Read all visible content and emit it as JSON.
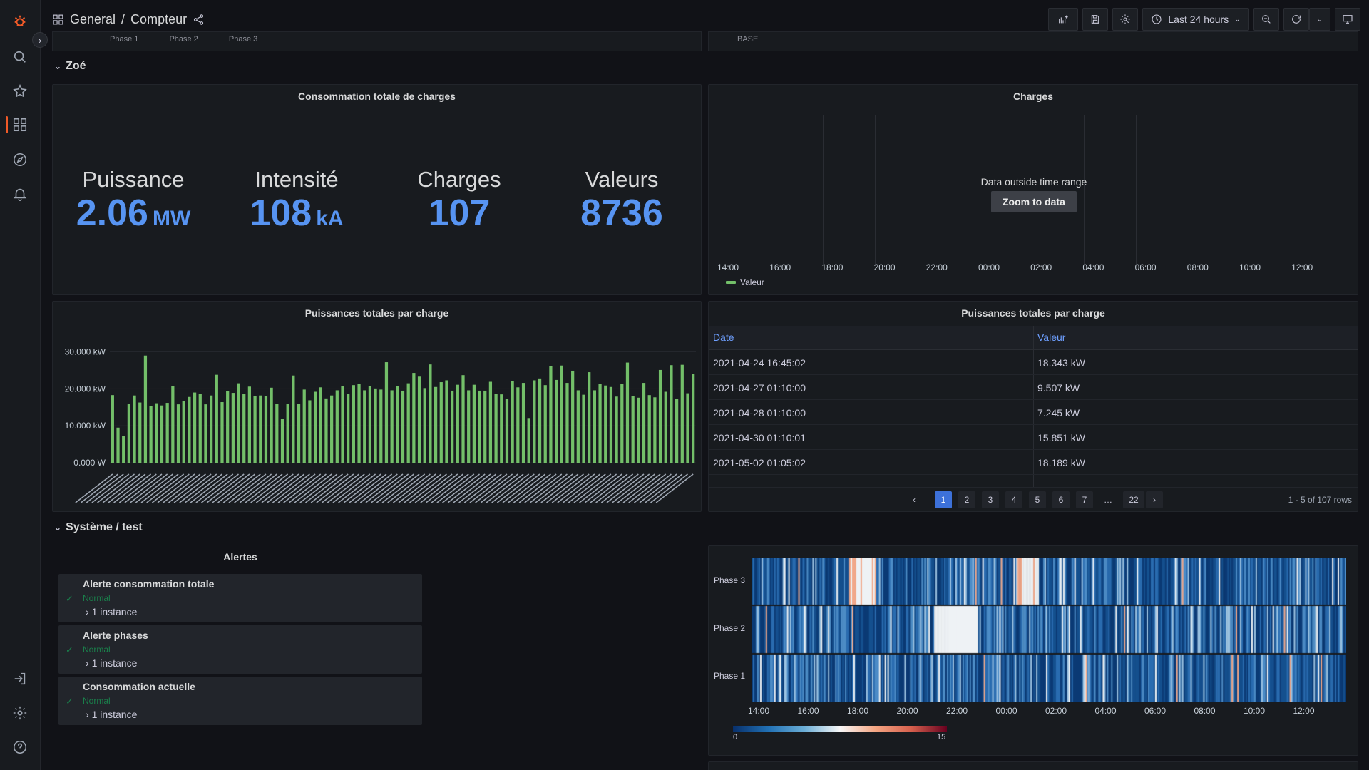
{
  "header": {
    "folder": "General",
    "separator": "/",
    "dashboard": "Compteur",
    "time_range": "Last 24 hours"
  },
  "partial_rows": {
    "left_labels": [
      "Phase 1",
      "Phase 2",
      "Phase 3"
    ],
    "right_label": "BASE"
  },
  "rows": [
    {
      "title": "Zoé"
    },
    {
      "title": "Système / test"
    }
  ],
  "stats_panel": {
    "title": "Consommation totale de charges",
    "stats": [
      {
        "label": "Puissance",
        "value": "2.06",
        "unit": "MW"
      },
      {
        "label": "Intensité",
        "value": "108",
        "unit": "kA"
      },
      {
        "label": "Charges",
        "value": "107",
        "unit": ""
      },
      {
        "label": "Valeurs",
        "value": "8736",
        "unit": ""
      }
    ]
  },
  "charges_panel": {
    "title": "Charges",
    "no_data_text": "Data outside time range",
    "zoom_button": "Zoom to data",
    "x_ticks": [
      "14:00",
      "16:00",
      "18:00",
      "20:00",
      "22:00",
      "00:00",
      "02:00",
      "04:00",
      "06:00",
      "08:00",
      "10:00",
      "12:00"
    ],
    "legend": "Valeur"
  },
  "bar_panel": {
    "title": "Puissances totales par charge",
    "bar_color": "#73bf69",
    "chart_data": {
      "type": "bar",
      "title": "Puissances totales par charge",
      "ylim": [
        0,
        33
      ],
      "y_ticks": [
        "30.000 kW",
        "20.000 kW",
        "10.000 kW",
        "0.000 W"
      ],
      "y_tick_values": [
        30,
        20,
        10,
        0
      ],
      "values": [
        18.3,
        9.5,
        7.2,
        15.9,
        18.2,
        16.3,
        29.0,
        15.4,
        16.1,
        15.5,
        16.2,
        20.8,
        15.8,
        16.7,
        17.8,
        19.0,
        18.6,
        15.8,
        18.2,
        23.8,
        16.4,
        19.4,
        18.9,
        21.5,
        18.7,
        20.6,
        18.0,
        18.2,
        18.1,
        20.3,
        15.9,
        11.8,
        15.9,
        23.6,
        16.0,
        19.8,
        16.9,
        19.2,
        20.4,
        17.4,
        18.2,
        19.6,
        20.8,
        18.6,
        21.0,
        21.3,
        19.6,
        20.8,
        20.1,
        19.8,
        27.2,
        19.6,
        20.7,
        19.5,
        21.5,
        24.3,
        23.3,
        20.2,
        26.6,
        20.5,
        21.8,
        22.3,
        19.5,
        21.1,
        23.7,
        19.6,
        21.1,
        19.5,
        19.5,
        21.9,
        18.7,
        18.5,
        17.2,
        22.0,
        20.4,
        21.6,
        12.1,
        22.3,
        22.8,
        21.0,
        26.1,
        22.4,
        26.3,
        21.6,
        24.9,
        19.6,
        18.4,
        24.5,
        19.6,
        21.3,
        20.9,
        20.5,
        17.9,
        21.4,
        27.1,
        18.0,
        17.6,
        21.6,
        18.3,
        17.7,
        25.1,
        19.2,
        26.4,
        17.3,
        26.5,
        18.8,
        24.0
      ]
    }
  },
  "table_panel": {
    "title": "Puissances totales par charge",
    "columns": [
      "Date",
      "Valeur"
    ],
    "rows": [
      [
        "2021-04-24 16:45:02",
        "18.343 kW"
      ],
      [
        "2021-04-27 01:10:00",
        "9.507 kW"
      ],
      [
        "2021-04-28 01:10:00",
        "7.245 kW"
      ],
      [
        "2021-04-30 01:10:01",
        "15.851 kW"
      ],
      [
        "2021-05-02 01:05:02",
        "18.189 kW"
      ]
    ],
    "pages": [
      "1",
      "2",
      "3",
      "4",
      "5",
      "6",
      "7",
      "…",
      "22"
    ],
    "prev": "‹",
    "next": "›",
    "info": "1 - 5 of 107 rows"
  },
  "alerts_panel": {
    "title": "Alertes",
    "items": [
      {
        "name": "Alerte consommation totale",
        "state": "Normal",
        "instances": "1 instance"
      },
      {
        "name": "Alerte phases",
        "state": "Normal",
        "instances": "1 instance"
      },
      {
        "name": "Consommation actuelle",
        "state": "Normal",
        "instances": "1 instance"
      }
    ]
  },
  "heatmap_panel": {
    "rows": [
      "Phase 3",
      "Phase 2",
      "Phase 1"
    ],
    "x_ticks": [
      "14:00",
      "16:00",
      "18:00",
      "20:00",
      "22:00",
      "00:00",
      "02:00",
      "04:00",
      "06:00",
      "08:00",
      "10:00",
      "12:00"
    ],
    "scale_min": "0",
    "scale_max": "15"
  }
}
